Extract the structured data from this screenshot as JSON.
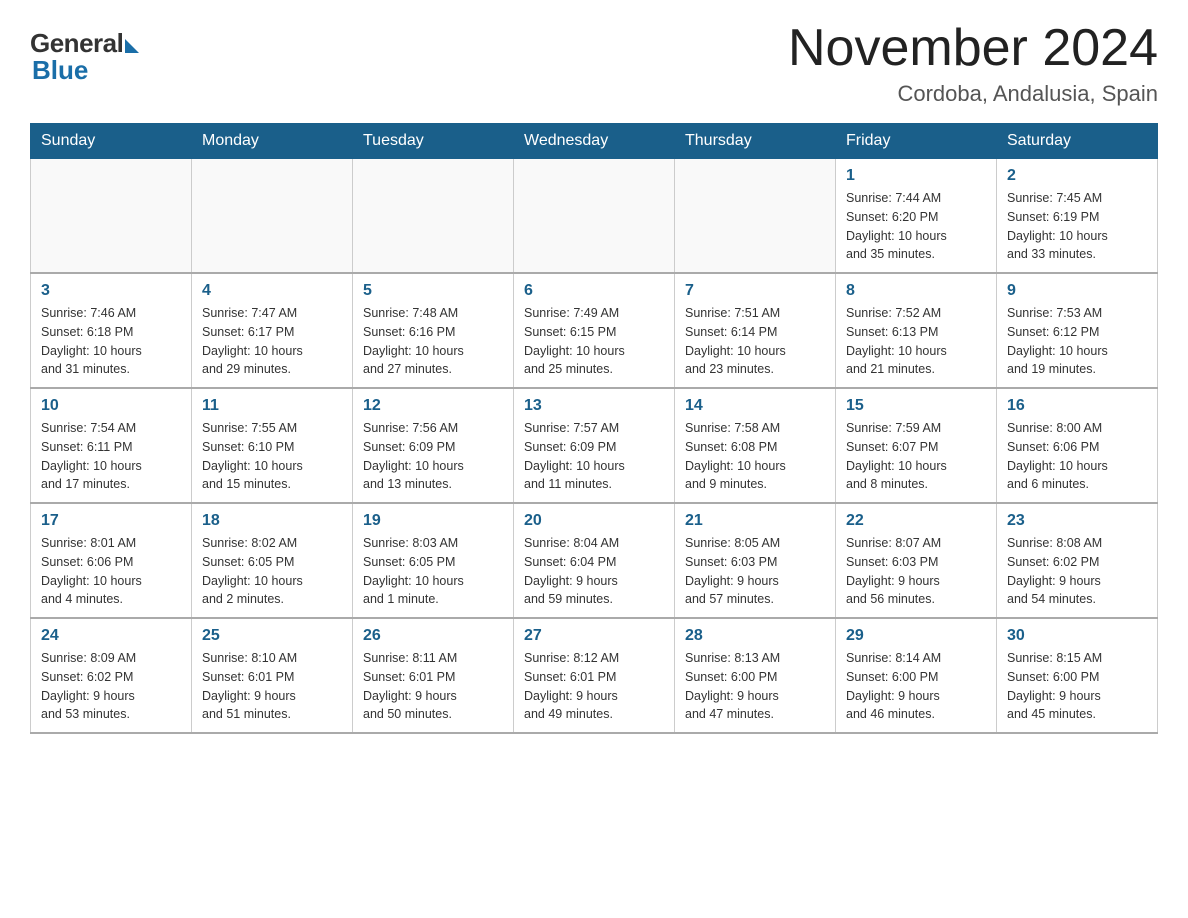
{
  "header": {
    "logo_general": "General",
    "logo_blue": "Blue",
    "month_title": "November 2024",
    "location": "Cordoba, Andalusia, Spain"
  },
  "weekdays": [
    "Sunday",
    "Monday",
    "Tuesday",
    "Wednesday",
    "Thursday",
    "Friday",
    "Saturday"
  ],
  "weeks": [
    [
      {
        "day": "",
        "info": ""
      },
      {
        "day": "",
        "info": ""
      },
      {
        "day": "",
        "info": ""
      },
      {
        "day": "",
        "info": ""
      },
      {
        "day": "",
        "info": ""
      },
      {
        "day": "1",
        "info": "Sunrise: 7:44 AM\nSunset: 6:20 PM\nDaylight: 10 hours\nand 35 minutes."
      },
      {
        "day": "2",
        "info": "Sunrise: 7:45 AM\nSunset: 6:19 PM\nDaylight: 10 hours\nand 33 minutes."
      }
    ],
    [
      {
        "day": "3",
        "info": "Sunrise: 7:46 AM\nSunset: 6:18 PM\nDaylight: 10 hours\nand 31 minutes."
      },
      {
        "day": "4",
        "info": "Sunrise: 7:47 AM\nSunset: 6:17 PM\nDaylight: 10 hours\nand 29 minutes."
      },
      {
        "day": "5",
        "info": "Sunrise: 7:48 AM\nSunset: 6:16 PM\nDaylight: 10 hours\nand 27 minutes."
      },
      {
        "day": "6",
        "info": "Sunrise: 7:49 AM\nSunset: 6:15 PM\nDaylight: 10 hours\nand 25 minutes."
      },
      {
        "day": "7",
        "info": "Sunrise: 7:51 AM\nSunset: 6:14 PM\nDaylight: 10 hours\nand 23 minutes."
      },
      {
        "day": "8",
        "info": "Sunrise: 7:52 AM\nSunset: 6:13 PM\nDaylight: 10 hours\nand 21 minutes."
      },
      {
        "day": "9",
        "info": "Sunrise: 7:53 AM\nSunset: 6:12 PM\nDaylight: 10 hours\nand 19 minutes."
      }
    ],
    [
      {
        "day": "10",
        "info": "Sunrise: 7:54 AM\nSunset: 6:11 PM\nDaylight: 10 hours\nand 17 minutes."
      },
      {
        "day": "11",
        "info": "Sunrise: 7:55 AM\nSunset: 6:10 PM\nDaylight: 10 hours\nand 15 minutes."
      },
      {
        "day": "12",
        "info": "Sunrise: 7:56 AM\nSunset: 6:09 PM\nDaylight: 10 hours\nand 13 minutes."
      },
      {
        "day": "13",
        "info": "Sunrise: 7:57 AM\nSunset: 6:09 PM\nDaylight: 10 hours\nand 11 minutes."
      },
      {
        "day": "14",
        "info": "Sunrise: 7:58 AM\nSunset: 6:08 PM\nDaylight: 10 hours\nand 9 minutes."
      },
      {
        "day": "15",
        "info": "Sunrise: 7:59 AM\nSunset: 6:07 PM\nDaylight: 10 hours\nand 8 minutes."
      },
      {
        "day": "16",
        "info": "Sunrise: 8:00 AM\nSunset: 6:06 PM\nDaylight: 10 hours\nand 6 minutes."
      }
    ],
    [
      {
        "day": "17",
        "info": "Sunrise: 8:01 AM\nSunset: 6:06 PM\nDaylight: 10 hours\nand 4 minutes."
      },
      {
        "day": "18",
        "info": "Sunrise: 8:02 AM\nSunset: 6:05 PM\nDaylight: 10 hours\nand 2 minutes."
      },
      {
        "day": "19",
        "info": "Sunrise: 8:03 AM\nSunset: 6:05 PM\nDaylight: 10 hours\nand 1 minute."
      },
      {
        "day": "20",
        "info": "Sunrise: 8:04 AM\nSunset: 6:04 PM\nDaylight: 9 hours\nand 59 minutes."
      },
      {
        "day": "21",
        "info": "Sunrise: 8:05 AM\nSunset: 6:03 PM\nDaylight: 9 hours\nand 57 minutes."
      },
      {
        "day": "22",
        "info": "Sunrise: 8:07 AM\nSunset: 6:03 PM\nDaylight: 9 hours\nand 56 minutes."
      },
      {
        "day": "23",
        "info": "Sunrise: 8:08 AM\nSunset: 6:02 PM\nDaylight: 9 hours\nand 54 minutes."
      }
    ],
    [
      {
        "day": "24",
        "info": "Sunrise: 8:09 AM\nSunset: 6:02 PM\nDaylight: 9 hours\nand 53 minutes."
      },
      {
        "day": "25",
        "info": "Sunrise: 8:10 AM\nSunset: 6:01 PM\nDaylight: 9 hours\nand 51 minutes."
      },
      {
        "day": "26",
        "info": "Sunrise: 8:11 AM\nSunset: 6:01 PM\nDaylight: 9 hours\nand 50 minutes."
      },
      {
        "day": "27",
        "info": "Sunrise: 8:12 AM\nSunset: 6:01 PM\nDaylight: 9 hours\nand 49 minutes."
      },
      {
        "day": "28",
        "info": "Sunrise: 8:13 AM\nSunset: 6:00 PM\nDaylight: 9 hours\nand 47 minutes."
      },
      {
        "day": "29",
        "info": "Sunrise: 8:14 AM\nSunset: 6:00 PM\nDaylight: 9 hours\nand 46 minutes."
      },
      {
        "day": "30",
        "info": "Sunrise: 8:15 AM\nSunset: 6:00 PM\nDaylight: 9 hours\nand 45 minutes."
      }
    ]
  ]
}
